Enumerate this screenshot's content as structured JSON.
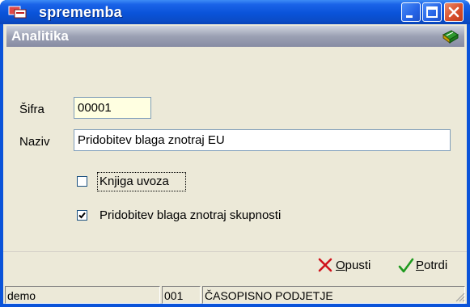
{
  "window": {
    "title": "sprememba",
    "icons": {
      "app": "app-window-icon",
      "minimize": "minimize-icon",
      "maximize": "maximize-icon",
      "close": "close-icon"
    }
  },
  "header": {
    "title": "Analitika",
    "icon": "book-icon"
  },
  "form": {
    "sifra": {
      "label": "Šifra",
      "value": "00001"
    },
    "naziv": {
      "label": "Naziv",
      "value": "Pridobitev blaga znotraj EU"
    },
    "knjiga_uvoza": {
      "label": "Knjiga uvoza",
      "checked": false
    },
    "pridobitev_skupnosti": {
      "label": "Pridobitev blaga znotraj skupnosti",
      "checked": true
    }
  },
  "buttons": {
    "opusti": {
      "accel": "O",
      "rest": "pusti",
      "icon": "cancel-x-icon"
    },
    "potrdi": {
      "accel": "P",
      "rest": "otrdi",
      "icon": "check-icon"
    }
  },
  "statusbar": {
    "user": "demo",
    "code": "001",
    "company": "ČASOPISNO PODJETJE"
  },
  "colors": {
    "titlebar": "#0a53d9",
    "header": "#9ba0b3",
    "client": "#ece9d8",
    "readonly_field": "#ffffe1",
    "cancel": "#d0121b",
    "confirm": "#1f9a1f"
  }
}
